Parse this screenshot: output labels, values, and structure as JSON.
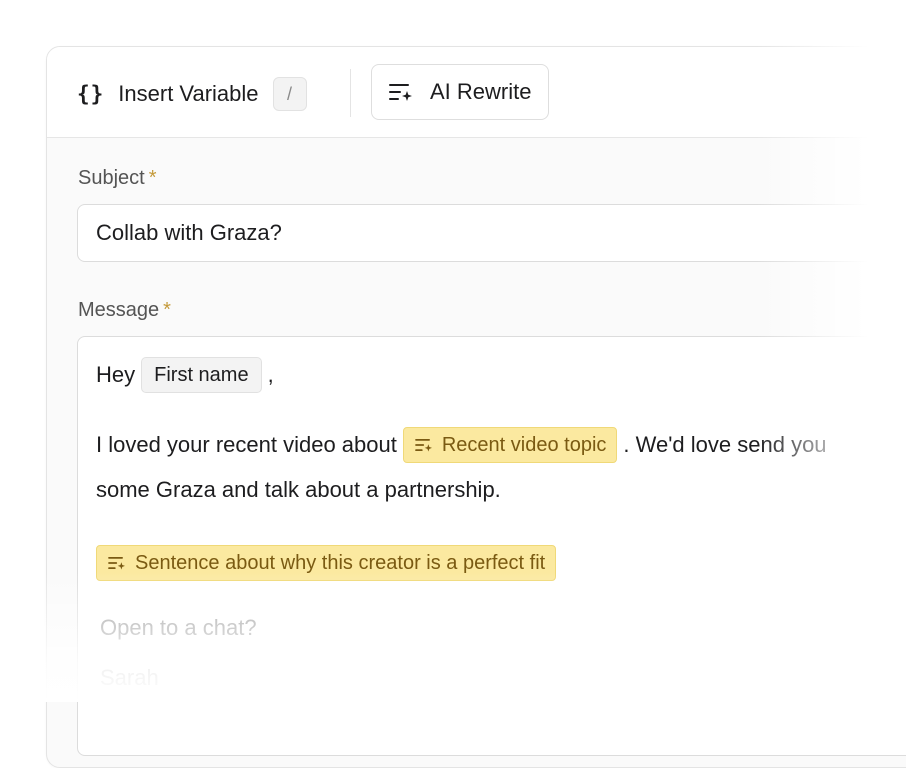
{
  "toolbar": {
    "insert_icon": "{}",
    "insert_label": "Insert Variable",
    "insert_shortcut": "/",
    "rewrite_label": "AI Rewrite",
    "rewrite_icon": "ai-sparkle-lines-icon"
  },
  "subject": {
    "label": "Subject",
    "required_mark": "*",
    "value": "Collab with Graza?"
  },
  "message": {
    "label": "Message",
    "required_mark": "*",
    "greeting": "Hey",
    "greeting_variable": "First name",
    "greeting_end": ",",
    "line2_text": "I loved your recent video about",
    "line2_ai_variable": "Recent video topic",
    "line2_after": ". We'd love send you",
    "line3_text": "some Graza and talk about a partnership.",
    "ai_sentence": "Sentence about why this creator is a perfect fit",
    "closing": "Open to a chat?",
    "signature": "Sarah"
  },
  "colors": {
    "accent_required": "#c49a3a",
    "ai_chip_bg": "#fbe9a0",
    "ai_chip_text": "#7a5a12"
  }
}
